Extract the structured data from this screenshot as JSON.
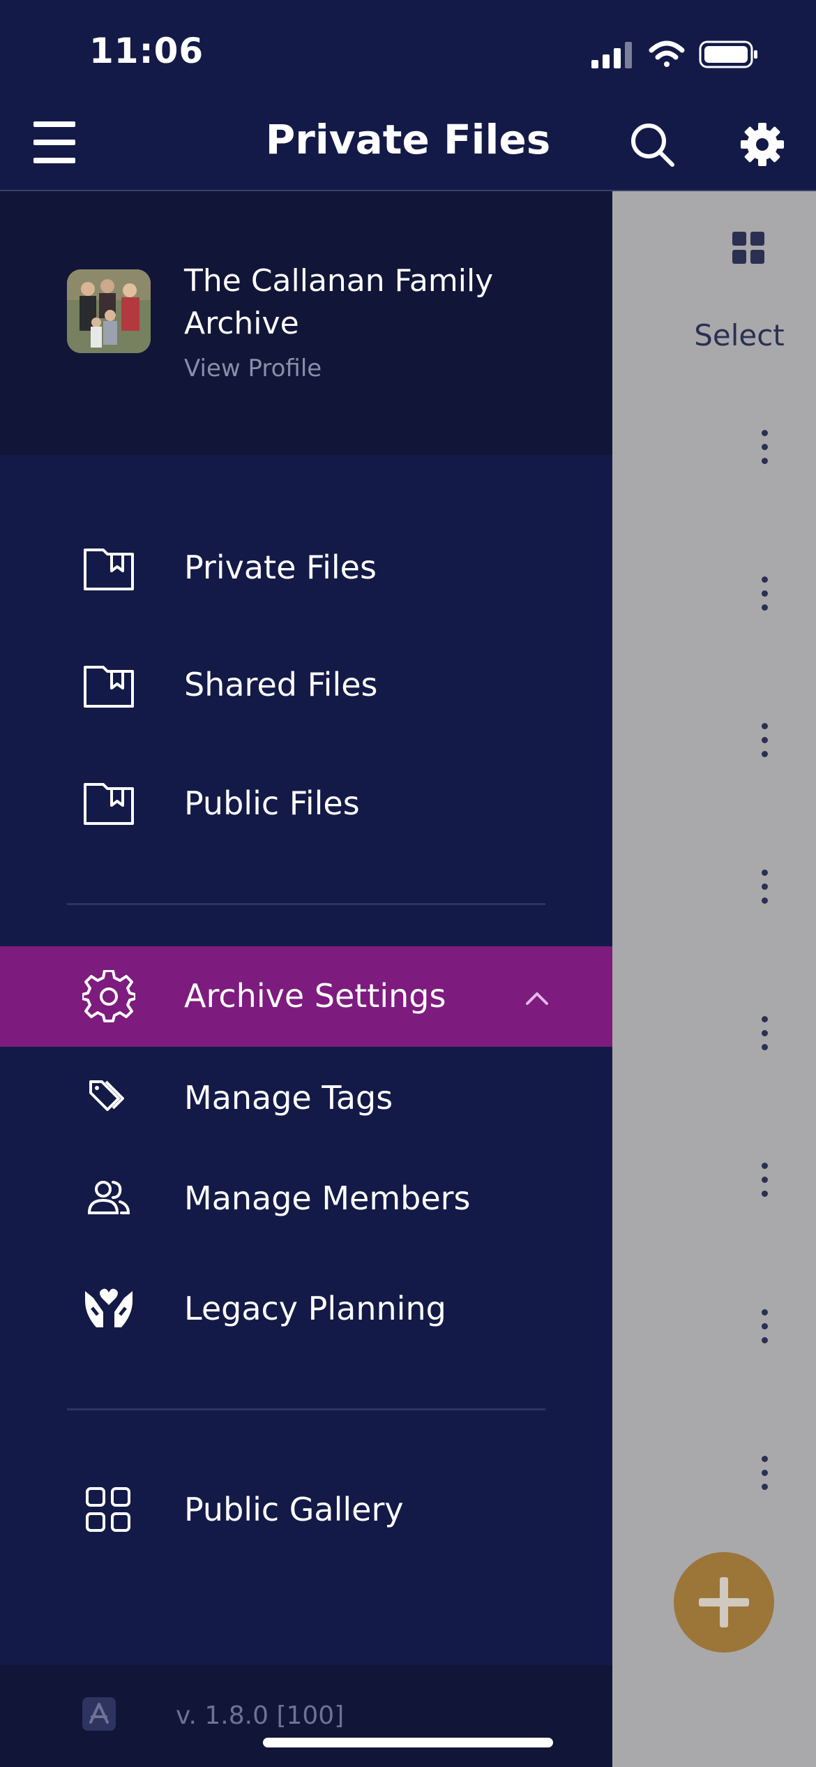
{
  "status_bar": {
    "time": "11:06"
  },
  "header": {
    "title": "Private Files"
  },
  "profile": {
    "name": "The Callanan Family Archive",
    "view_profile": "View Profile"
  },
  "drawer": {
    "items": [
      {
        "label": "Private Files",
        "icon": "folder-bookmark-icon"
      },
      {
        "label": "Shared Files",
        "icon": "folder-bookmark-icon"
      },
      {
        "label": "Public Files",
        "icon": "folder-bookmark-icon"
      }
    ],
    "archive_settings": {
      "label": "Archive Settings",
      "icon": "gear-icon",
      "expanded": true,
      "subitems": [
        {
          "label": "Manage Tags",
          "icon": "tags-icon"
        },
        {
          "label": "Manage Members",
          "icon": "members-icon"
        },
        {
          "label": "Legacy Planning",
          "icon": "heart-hands-icon"
        }
      ]
    },
    "gallery": {
      "label": "Public Gallery",
      "icon": "grid-icon"
    },
    "version": "v. 1.8.0 [100]"
  },
  "background": {
    "select_label": "Select"
  },
  "colors": {
    "navy": "#141a47",
    "navy_dark": "#111537",
    "active_purple": "#7d1b7e",
    "fab_gold": "#9c7638",
    "overlay_gray": "#a9a9ab"
  }
}
